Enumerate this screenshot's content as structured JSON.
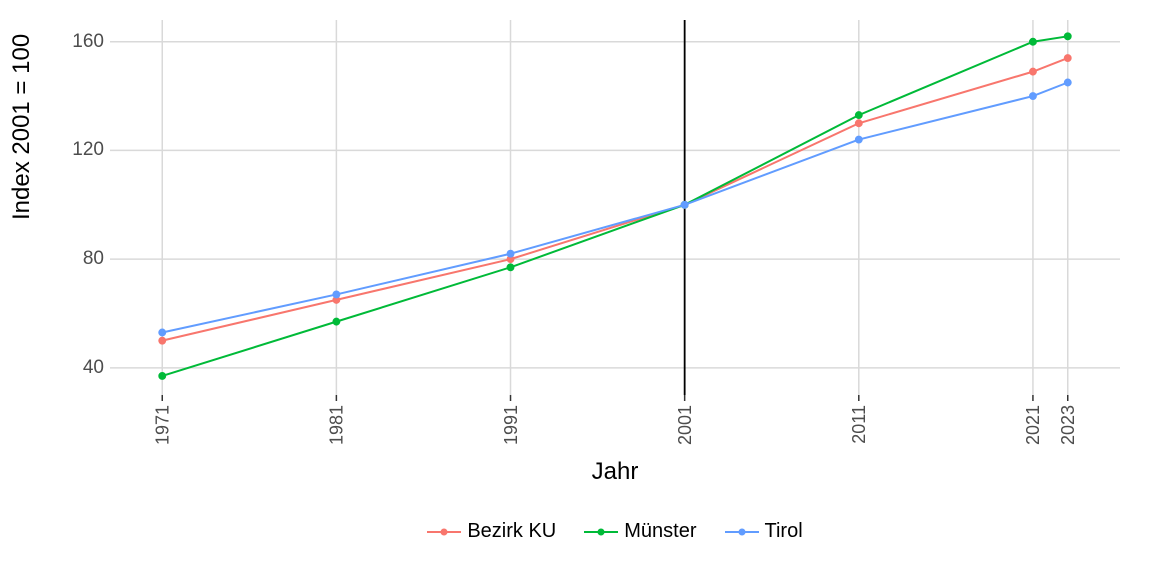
{
  "chart_data": {
    "type": "line",
    "xlabel": "Jahr",
    "ylabel": "Index 2001 = 100",
    "x": [
      1971,
      1981,
      1991,
      2001,
      2011,
      2021,
      2023
    ],
    "x_ticklabels": [
      "1971",
      "1981",
      "1991",
      "2001",
      "2011",
      "2021",
      "2023"
    ],
    "y_ticks": [
      40,
      80,
      120,
      160
    ],
    "ylim": [
      30,
      168
    ],
    "xlim": [
      1968,
      2026
    ],
    "reference_x": 2001,
    "series": [
      {
        "name": "Bezirk KU",
        "color": "#F8766D",
        "values": [
          50,
          65,
          80,
          100,
          130,
          149,
          154
        ]
      },
      {
        "name": "Münster",
        "color": "#00BA38",
        "values": [
          37,
          57,
          77,
          100,
          133,
          160,
          162
        ]
      },
      {
        "name": "Tirol",
        "color": "#619CFF",
        "values": [
          53,
          67,
          82,
          100,
          124,
          140,
          145
        ]
      }
    ],
    "legend_position": "bottom"
  }
}
